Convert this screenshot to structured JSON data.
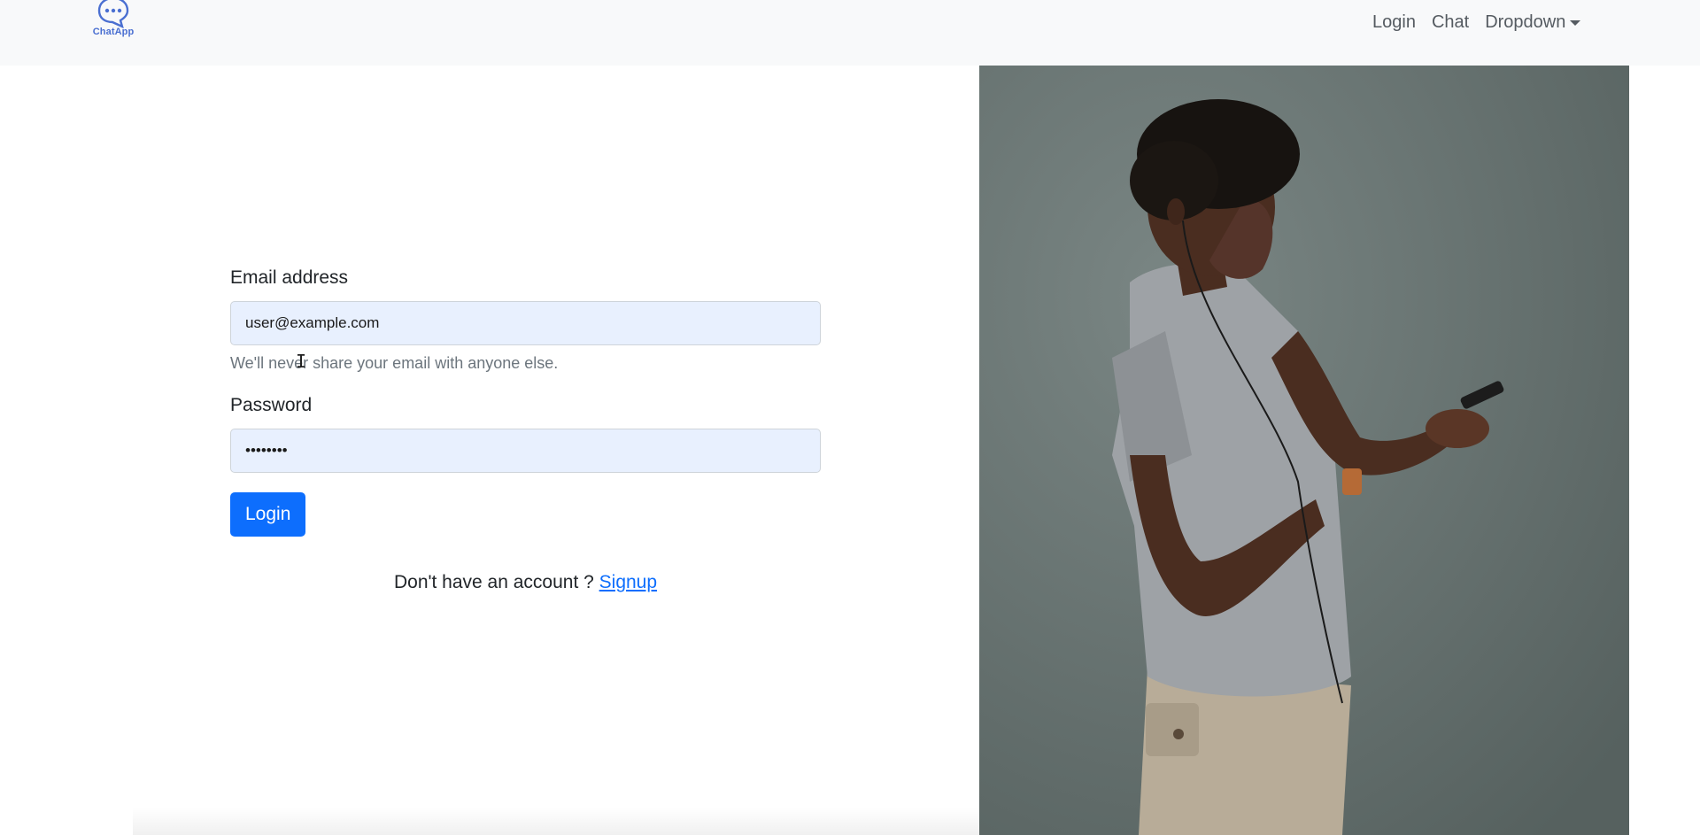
{
  "navbar": {
    "brand": "ChatApp",
    "links": [
      "Login",
      "Chat",
      "Dropdown"
    ]
  },
  "form": {
    "email_label": "Email address",
    "email_value": "user@example.com",
    "email_help": "We'll never share your email with anyone else.",
    "password_label": "Password",
    "password_value": "password",
    "submit_label": "Login"
  },
  "signup": {
    "prompt": "Don't have an account ? ",
    "link_label": "Signup"
  },
  "icons": {
    "brand_icon": "chat-bubble-icon",
    "dropdown_caret": "caret-down-icon"
  },
  "colors": {
    "primary": "#0d6efd",
    "input_bg": "#e8f0fe",
    "navbar_bg": "#f8f9fa",
    "brand": "#4a6fd1"
  }
}
